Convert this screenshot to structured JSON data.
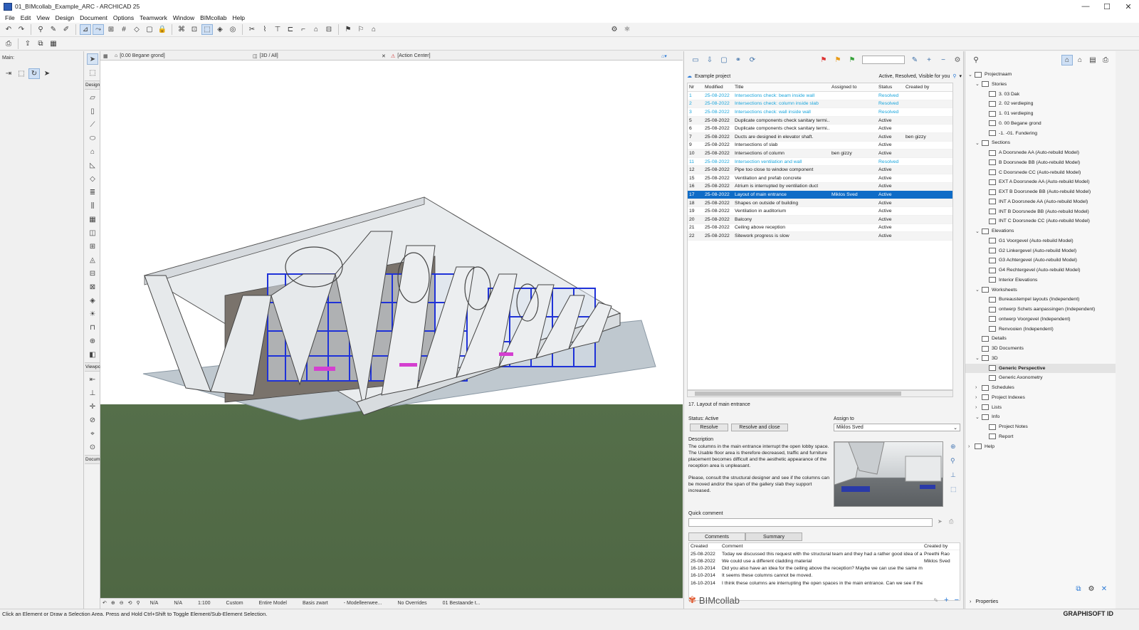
{
  "window": {
    "title": "01_BIMcollab_Example_ARC - ARCHICAD 25",
    "min": "—",
    "max": "☐",
    "close": "✕"
  },
  "menu": [
    "File",
    "Edit",
    "View",
    "Design",
    "Document",
    "Options",
    "Teamwork",
    "Window",
    "BIMcollab",
    "Help"
  ],
  "infobox": {
    "label": "Main:"
  },
  "toolbox": {
    "design_label": "Design",
    "viewpoint_label": "Viewpc",
    "document_label": "Docum"
  },
  "view_tabs": {
    "tab1": "[0.00 Begane grond]",
    "tab2": "[3D / All]",
    "tab3": "[Action Center]"
  },
  "viewport_status": {
    "na1": "N/A",
    "na2": "N/A",
    "scale": "1:100",
    "custom": "Custom",
    "model": "Entire Model",
    "pen": "Basis zwart",
    "mvo": "- Modelleerwee...",
    "override": "No Overrides",
    "reno": "01 Bestaande t..."
  },
  "statusbar": "Click an Element or Draw a Selection Area. Press and Hold Ctrl+Shift to Toggle Element/Sub-Element Selection.",
  "bimcollab": {
    "project": "Example project",
    "filter": "Active, Resolved, Visible for you",
    "columns": {
      "nr": "Nr",
      "modified": "Modified",
      "title": "Title",
      "assigned": "Assigned to",
      "status": "Status",
      "created": "Created by"
    },
    "issues": [
      {
        "nr": "1",
        "modified": "25-08-2022",
        "title": "Intersections check: beam inside wall",
        "assigned": "",
        "status": "Resolved",
        "created": ""
      },
      {
        "nr": "2",
        "modified": "25-08-2022",
        "title": "Intersections check: column inside slab",
        "assigned": "",
        "status": "Resolved",
        "created": ""
      },
      {
        "nr": "3",
        "modified": "25-08-2022",
        "title": "Intersections check: wall inside wall",
        "assigned": "",
        "status": "Resolved",
        "created": ""
      },
      {
        "nr": "5",
        "modified": "25-08-2022",
        "title": "Duplicate components check sanitary termi...",
        "assigned": "",
        "status": "Active",
        "created": ""
      },
      {
        "nr": "6",
        "modified": "25-08-2022",
        "title": "Duplicate components check sanitary termi...",
        "assigned": "",
        "status": "Active",
        "created": ""
      },
      {
        "nr": "7",
        "modified": "25-08-2022",
        "title": "Ducts are designed in elevator shaft.",
        "assigned": "",
        "status": "Active",
        "created": "ben gizzy"
      },
      {
        "nr": "9",
        "modified": "25-08-2022",
        "title": "Intersections of slab",
        "assigned": "",
        "status": "Active",
        "created": ""
      },
      {
        "nr": "10",
        "modified": "25-08-2022",
        "title": "Intersections of column",
        "assigned": "ben gizzy",
        "status": "Active",
        "created": ""
      },
      {
        "nr": "11",
        "modified": "25-08-2022",
        "title": "Intersection ventilation and wall",
        "assigned": "",
        "status": "Resolved",
        "created": ""
      },
      {
        "nr": "12",
        "modified": "25-08-2022",
        "title": "Pipe too close to window component",
        "assigned": "",
        "status": "Active",
        "created": ""
      },
      {
        "nr": "15",
        "modified": "25-08-2022",
        "title": "Ventilation and prefab concrete",
        "assigned": "",
        "status": "Active",
        "created": ""
      },
      {
        "nr": "16",
        "modified": "25-08-2022",
        "title": "Atrium is interrupted by ventilation duct",
        "assigned": "",
        "status": "Active",
        "created": ""
      },
      {
        "nr": "17",
        "modified": "25-08-2022",
        "title": "Layout of main entrance",
        "assigned": "Miklos Sved",
        "status": "Active",
        "created": ""
      },
      {
        "nr": "18",
        "modified": "25-08-2022",
        "title": "Shapes on outside of building",
        "assigned": "",
        "status": "Active",
        "created": ""
      },
      {
        "nr": "19",
        "modified": "25-08-2022",
        "title": "Ventilation in auditorium",
        "assigned": "",
        "status": "Active",
        "created": ""
      },
      {
        "nr": "20",
        "modified": "25-08-2022",
        "title": "Balcony",
        "assigned": "",
        "status": "Active",
        "created": ""
      },
      {
        "nr": "21",
        "modified": "25-08-2022",
        "title": "Ceiling above reception",
        "assigned": "",
        "status": "Active",
        "created": ""
      },
      {
        "nr": "22",
        "modified": "25-08-2022",
        "title": "Sitework progress is slow",
        "assigned": "",
        "status": "Active",
        "created": ""
      }
    ],
    "selected_title": "17. Layout of main entrance",
    "status_text": "Status: Active",
    "resolve": "Resolve",
    "resolve_close": "Resolve and close",
    "assign_label": "Assign to",
    "assign_value": "Miklos Sved",
    "description_label": "Description",
    "description": "The columns in the main entrance interrupt the open lobby space. The Usable floor area is therefore decreased, traffic and furniture placement becomes difficult and the aesthetic appearance of the reception area is unpleasant.",
    "description2": "Please, consult the structural designer and see if the columns can be moved and/or the span of the  gallery slab they support increased.",
    "quick_comment_label": "Quick comment",
    "tab_comments": "Comments",
    "tab_summary": "Summary",
    "comment_columns": {
      "created": "Created",
      "comment": "Comment",
      "by": "Created by"
    },
    "comments": [
      {
        "date": "25-08-2022",
        "text": "Today we discussed this request with the structural team and they had a rather good idea of a ...",
        "by": "Preethi Rao"
      },
      {
        "date": "25-08-2022",
        "text": "We could use a different cladding material",
        "by": "Miklos Sved"
      },
      {
        "date": "16-10-2014",
        "text": "Did you also have an idea for the ceiling above the reception? Maybe we can use the same ma...",
        "by": ""
      },
      {
        "date": "16-10-2014",
        "text": "It seems these columns cannot be moved.",
        "by": ""
      },
      {
        "date": "16-10-2014",
        "text": "I think these columns are interrupting the open spaces in the main entrance. Can we see if the...",
        "by": ""
      }
    ],
    "logo_text": "BIMcollab"
  },
  "navigator": {
    "items": [
      "Projectnaam",
      "Stories",
      "3. 03 Dak",
      "2. 02 verdieping",
      "1. 01 verdieping",
      "0. 00 Begane grond",
      "-1. -01. Fundering",
      "Sections",
      "A Doorsnede AA (Auto-rebuild Model)",
      "B Doorsnede BB (Auto-rebuild Model)",
      "C Doorsnede CC (Auto-rebuild Model)",
      "EXT A Doorsnede AA (Auto-rebuild Model)",
      "EXT B Doorsnede BB (Auto-rebuild Model)",
      "INT A Doorsnede AA (Auto-rebuild Model)",
      "INT B Doorsnede BB (Auto-rebuild Model)",
      "INT C Doorsnede CC (Auto-rebuild Model)",
      "Elevations",
      "G1 Voorgevel (Auto-rebuild Model)",
      "G2 Linkergevel (Auto-rebuild Model)",
      "G3 Achtergevel (Auto-rebuild Model)",
      "G4 Rechtergevel (Auto-rebuild Model)",
      "Interior Elevations",
      "Worksheets",
      "Bureaustempel layouts (Independent)",
      "ontwerp Schets aanpassingen (Independent)",
      "ontwerp Voorgevel (Independent)",
      "Renvooien (Independent)",
      "Details",
      "3D Documents",
      "3D",
      "Generic Perspective",
      "Generic Axonometry",
      "Schedules",
      "Project Indexes",
      "Lists",
      "Info",
      "Project Notes",
      "Report",
      "Help"
    ],
    "properties": "Properties"
  },
  "graphisoft_id": "GRAPHISOFT ID",
  "colors": {
    "accent": "#0f6cc7",
    "resolved": "#19a5dc"
  }
}
